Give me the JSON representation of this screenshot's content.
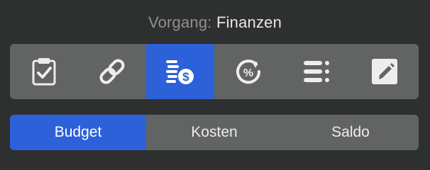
{
  "header": {
    "prefix": "Vorgang:",
    "value": "Finanzen"
  },
  "toolbar": {
    "selected_index": 2,
    "items": [
      {
        "icon": "clipboard-check-icon"
      },
      {
        "icon": "link-icon"
      },
      {
        "icon": "coins-dollar-icon"
      },
      {
        "icon": "percent-refresh-icon"
      },
      {
        "icon": "list-icon"
      },
      {
        "icon": "edit-icon"
      }
    ]
  },
  "segments": {
    "selected_index": 0,
    "items": [
      {
        "label": "Budget"
      },
      {
        "label": "Kosten"
      },
      {
        "label": "Saldo"
      }
    ]
  },
  "colors": {
    "background": "#2e302f",
    "control": "#616463",
    "accent": "#2d61d9",
    "icon": "#ededed"
  }
}
